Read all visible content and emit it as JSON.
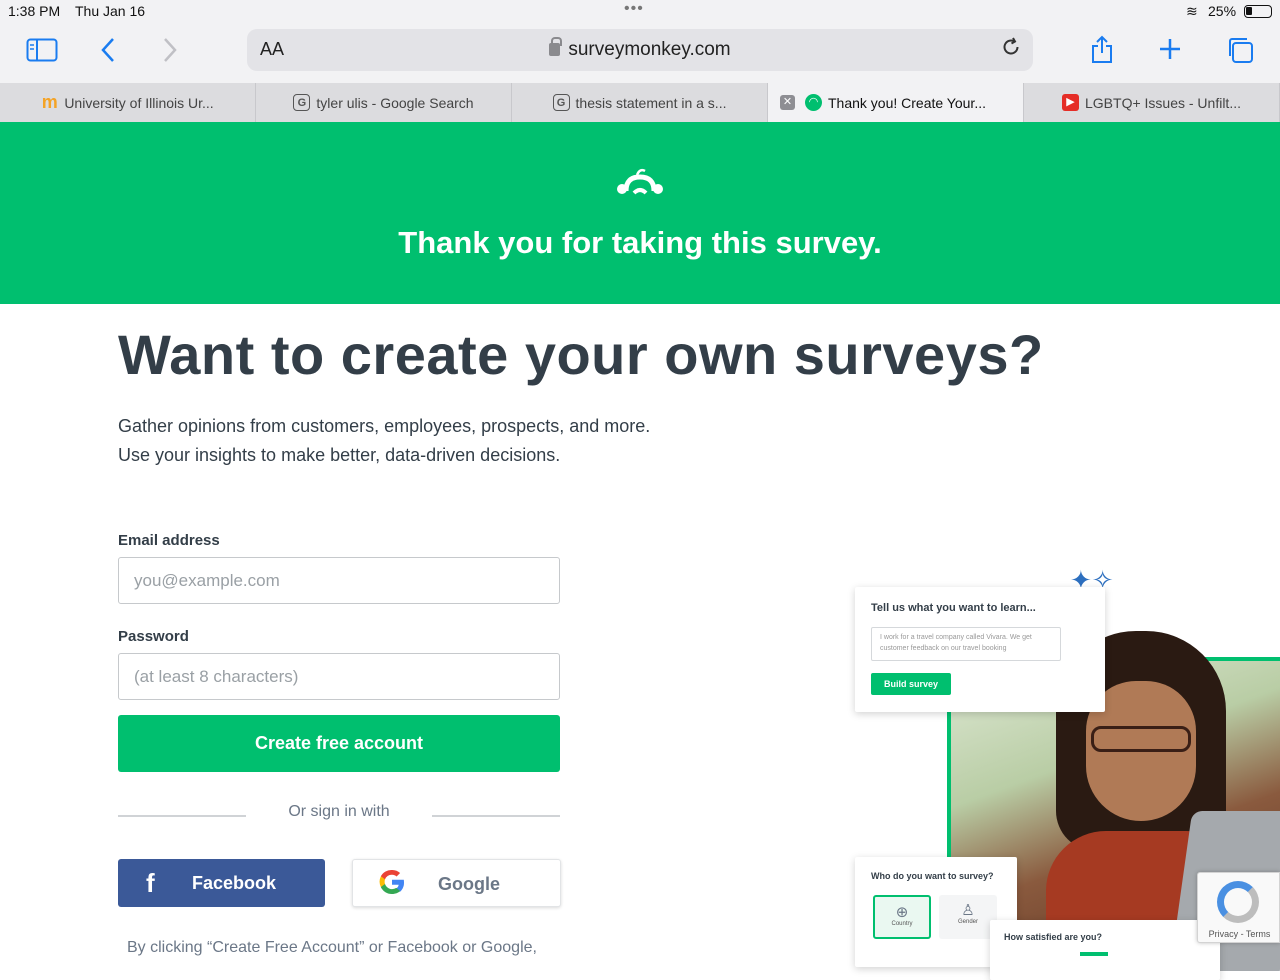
{
  "status_bar": {
    "time": "1:38 PM",
    "date": "Thu Jan 16",
    "battery": "25%"
  },
  "browser": {
    "text_size_label": "AA",
    "url": "surveymonkey.com",
    "tabs": [
      {
        "title": "University of Illinois Ur...",
        "favicon": "m",
        "active": false
      },
      {
        "title": "tyler ulis - Google Search",
        "favicon": "G",
        "active": false
      },
      {
        "title": "thesis statement in a s...",
        "favicon": "G",
        "active": false
      },
      {
        "title": "Thank you! Create Your...",
        "favicon": "surveymonkey",
        "active": true
      },
      {
        "title": "LGBTQ+ Issues - Unfilt...",
        "favicon": "youtube",
        "active": false
      }
    ]
  },
  "hero": {
    "title": "Thank you for taking this survey."
  },
  "main": {
    "headline": "Want to create your own surveys?",
    "desc_line1": "Gather opinions from customers, employees, prospects, and more.",
    "desc_line2": "Use your insights to make better, data-driven decisions.",
    "email_label": "Email address",
    "email_placeholder": "you@example.com",
    "email_value": "",
    "password_label": "Password",
    "password_placeholder": "(at least 8 characters)",
    "password_value": "",
    "cta_label": "Create free account",
    "divider_text": "Or sign in with",
    "facebook_label": "Facebook",
    "google_label": "Google",
    "legal": "By clicking “Create Free Account” or Facebook or Google,"
  },
  "illustration": {
    "card1_title": "Tell us what you want to learn...",
    "card1_text": "I work for a travel company called Vivara. We get customer feedback on our travel booking",
    "card1_button": "Build survey",
    "card2_title": "Who do you want to survey?",
    "card2_opt1": "Country",
    "card2_opt2": "Gender",
    "card3_title": "How satisfied are you?"
  },
  "recaptcha": {
    "text": "Privacy - Terms"
  },
  "colors": {
    "brand_green": "#00bf6f",
    "facebook_blue": "#3b5998",
    "text_dark": "#333e48",
    "ios_blue": "#1a7cf0"
  }
}
